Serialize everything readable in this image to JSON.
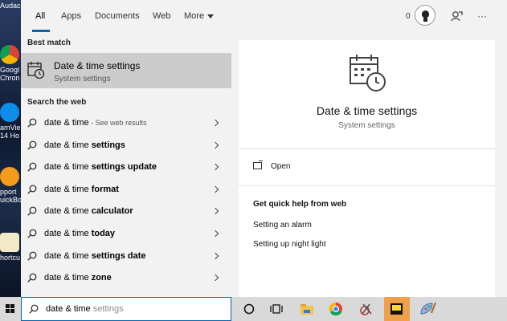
{
  "desktop": {
    "icons": [
      {
        "label": "Audac"
      },
      {
        "label": "Googl"
      },
      {
        "label": "Chron"
      },
      {
        "label": "amVie"
      },
      {
        "label": "14 Ho"
      },
      {
        "label": "pport"
      },
      {
        "label": "uickBo"
      },
      {
        "label": "hortcu"
      }
    ]
  },
  "tabs": {
    "all": "All",
    "apps": "Apps",
    "documents": "Documents",
    "web": "Web",
    "more": "More",
    "points": "0",
    "ellipsis": "···"
  },
  "best_match": {
    "heading": "Best match",
    "title": "Date & time settings",
    "subtitle": "System settings"
  },
  "web": {
    "heading": "Search the web",
    "prefix": "date & time",
    "results": [
      {
        "suffix": "",
        "note": " - See web results"
      },
      {
        "suffix": " settings",
        "note": ""
      },
      {
        "suffix": " settings update",
        "note": ""
      },
      {
        "suffix": " format",
        "note": ""
      },
      {
        "suffix": " calculator",
        "note": ""
      },
      {
        "suffix": " today",
        "note": ""
      },
      {
        "suffix": " settings date",
        "note": ""
      },
      {
        "suffix": " zone",
        "note": ""
      }
    ]
  },
  "preview": {
    "title": "Date & time settings",
    "subtitle": "System settings",
    "open": "Open",
    "quick_help": "Get quick help from web",
    "links": [
      "Setting an alarm",
      "Setting up night light"
    ]
  },
  "search": {
    "typed": "date & time",
    "completion": " settings"
  },
  "taskbar": {
    "items": [
      "cortana-icon",
      "task-view-icon",
      "file-explorer-icon",
      "chrome-icon",
      "snipping-tool-icon",
      "sticky-notes-icon",
      "paint-icon"
    ]
  },
  "colors": {
    "accent": "#0063b1",
    "selected_row": "#cccccc",
    "active_taskbar": "#f0a04b"
  }
}
